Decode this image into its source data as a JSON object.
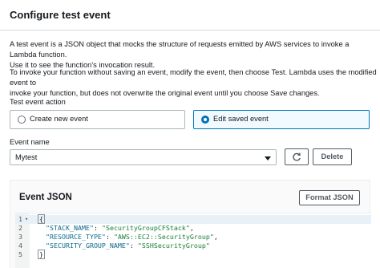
{
  "modal": {
    "title": "Configure test event"
  },
  "intro": {
    "p1_line1": "A test event is a JSON object that mocks the structure of requests emitted by AWS services to invoke a Lambda function.",
    "p1_line2": "Use it to see the function's invocation result.",
    "p2_line1": "To invoke your function without saving an event, modify the event, then choose Test. Lambda uses the modified event to",
    "p2_line2": "invoke your function, but does not overwrite the original event until you choose Save changes."
  },
  "test_event_action": {
    "label": "Test event action",
    "options": [
      {
        "label": "Create new event",
        "selected": false
      },
      {
        "label": "Edit saved event",
        "selected": true
      }
    ]
  },
  "event_name": {
    "label": "Event name",
    "value": "Mytest",
    "delete_label": "Delete",
    "refresh_icon": "refresh-icon"
  },
  "event_json": {
    "title": "Event JSON",
    "format_label": "Format JSON",
    "lines": [
      {
        "num": "1",
        "text": "{"
      },
      {
        "num": "2",
        "key": "\"STACK_NAME\"",
        "value": "\"SecurityGroupCFStack\"",
        "trail": ","
      },
      {
        "num": "3",
        "key": "\"RESOURCE_TYPE\"",
        "value": "\"AWS::EC2::SecurityGroup\"",
        "trail": ","
      },
      {
        "num": "4",
        "key": "\"SECURITY_GROUP_NAME\"",
        "value": "\"SSHSecurityGroup\"",
        "trail": ""
      },
      {
        "num": "5",
        "text": "}"
      }
    ]
  },
  "colors": {
    "accent": "#0073bb",
    "selected_bg": "#f1faff"
  }
}
